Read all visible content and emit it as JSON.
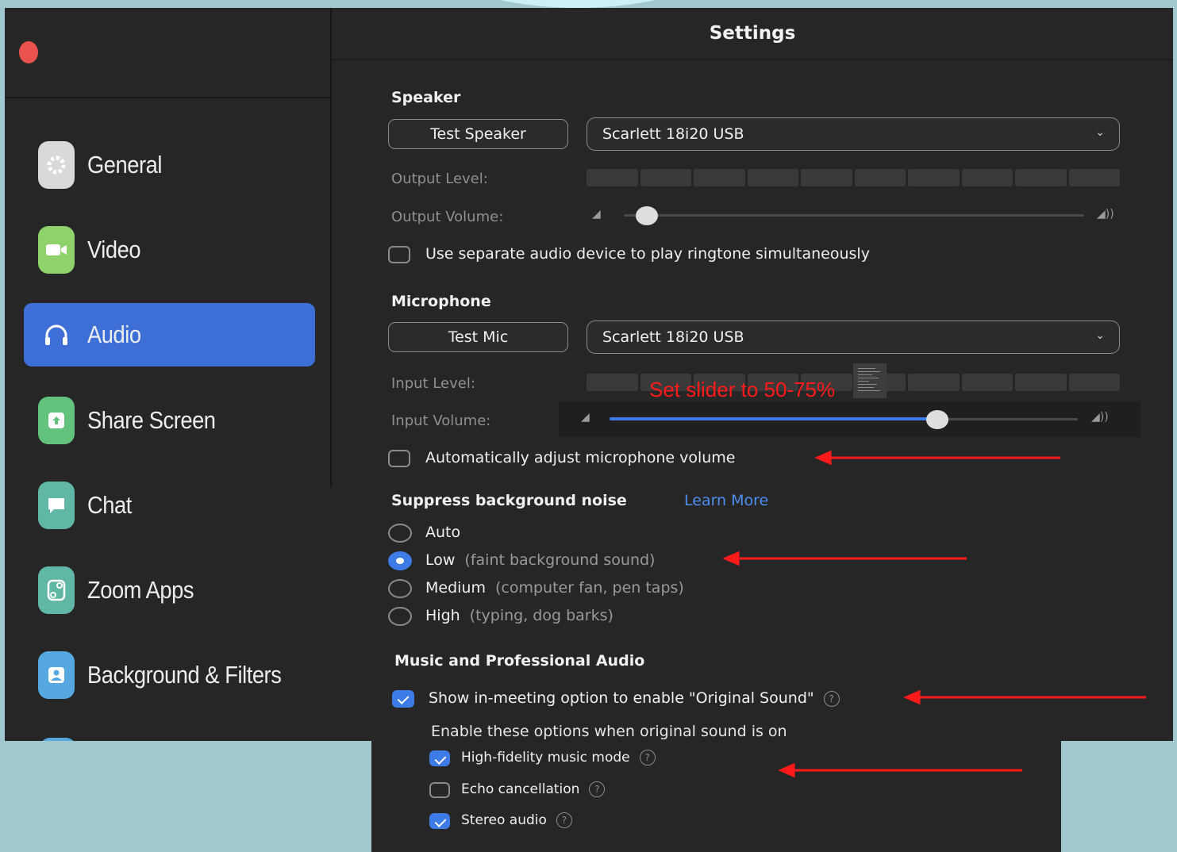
{
  "window": {
    "title": "Settings"
  },
  "sidebar": {
    "items": [
      {
        "label": "General",
        "icon": "gear-icon",
        "color": "#d9d9d9",
        "active": false
      },
      {
        "label": "Video",
        "icon": "video-camera-icon",
        "color": "#8fd26b",
        "active": false
      },
      {
        "label": "Audio",
        "icon": "headphones-icon",
        "color": "#3d6fd6",
        "active": true
      },
      {
        "label": "Share Screen",
        "icon": "share-screen-icon",
        "color": "#63c27c",
        "active": false
      },
      {
        "label": "Chat",
        "icon": "chat-bubble-icon",
        "color": "#5fb7a4",
        "active": false
      },
      {
        "label": "Zoom Apps",
        "icon": "zoom-apps-icon",
        "color": "#5fb7a4",
        "active": false
      },
      {
        "label": "Background & Filters",
        "icon": "background-filters-icon",
        "color": "#56a8e0",
        "active": false
      }
    ]
  },
  "speaker": {
    "section_title": "Speaker",
    "test_button": "Test Speaker",
    "device": "Scarlett 18i20 USB",
    "output_level_label": "Output Level:",
    "output_volume_label": "Output Volume:",
    "output_volume": 0.05,
    "separate_device_label": "Use separate audio device to play ringtone simultaneously",
    "separate_device_checked": false
  },
  "microphone": {
    "section_title": "Microphone",
    "test_button": "Test Mic",
    "device": "Scarlett 18i20 USB",
    "input_level_label": "Input Level:",
    "input_volume_label": "Input Volume:",
    "input_volume": 0.7,
    "auto_adjust_label": "Automatically adjust microphone volume",
    "auto_adjust_checked": false
  },
  "suppress": {
    "section_title": "Suppress background noise",
    "learn_more": "Learn More",
    "options": [
      {
        "label": "Auto",
        "hint": "",
        "selected": false
      },
      {
        "label": "Low",
        "hint": "(faint background sound)",
        "selected": true
      },
      {
        "label": "Medium",
        "hint": "(computer fan, pen taps)",
        "selected": false
      },
      {
        "label": "High",
        "hint": "(typing, dog barks)",
        "selected": false
      }
    ]
  },
  "music": {
    "section_title": "Music and Professional Audio",
    "original_sound_label": "Show in-meeting option to enable \"Original Sound\"",
    "original_sound_checked": true,
    "sub_heading": "Enable these options when original sound is on",
    "options": [
      {
        "label": "High-fidelity music mode",
        "checked": true
      },
      {
        "label": "Echo cancellation",
        "checked": false
      },
      {
        "label": "Stereo audio",
        "checked": true
      }
    ]
  },
  "annotation": {
    "text": "Set slider to 50-75%",
    "color": "#ff1a1a"
  },
  "colors": {
    "accent": "#3d7be6",
    "window_bg": "#262626",
    "page_bg": "#a2c8cf",
    "link": "#4e8ef0"
  }
}
